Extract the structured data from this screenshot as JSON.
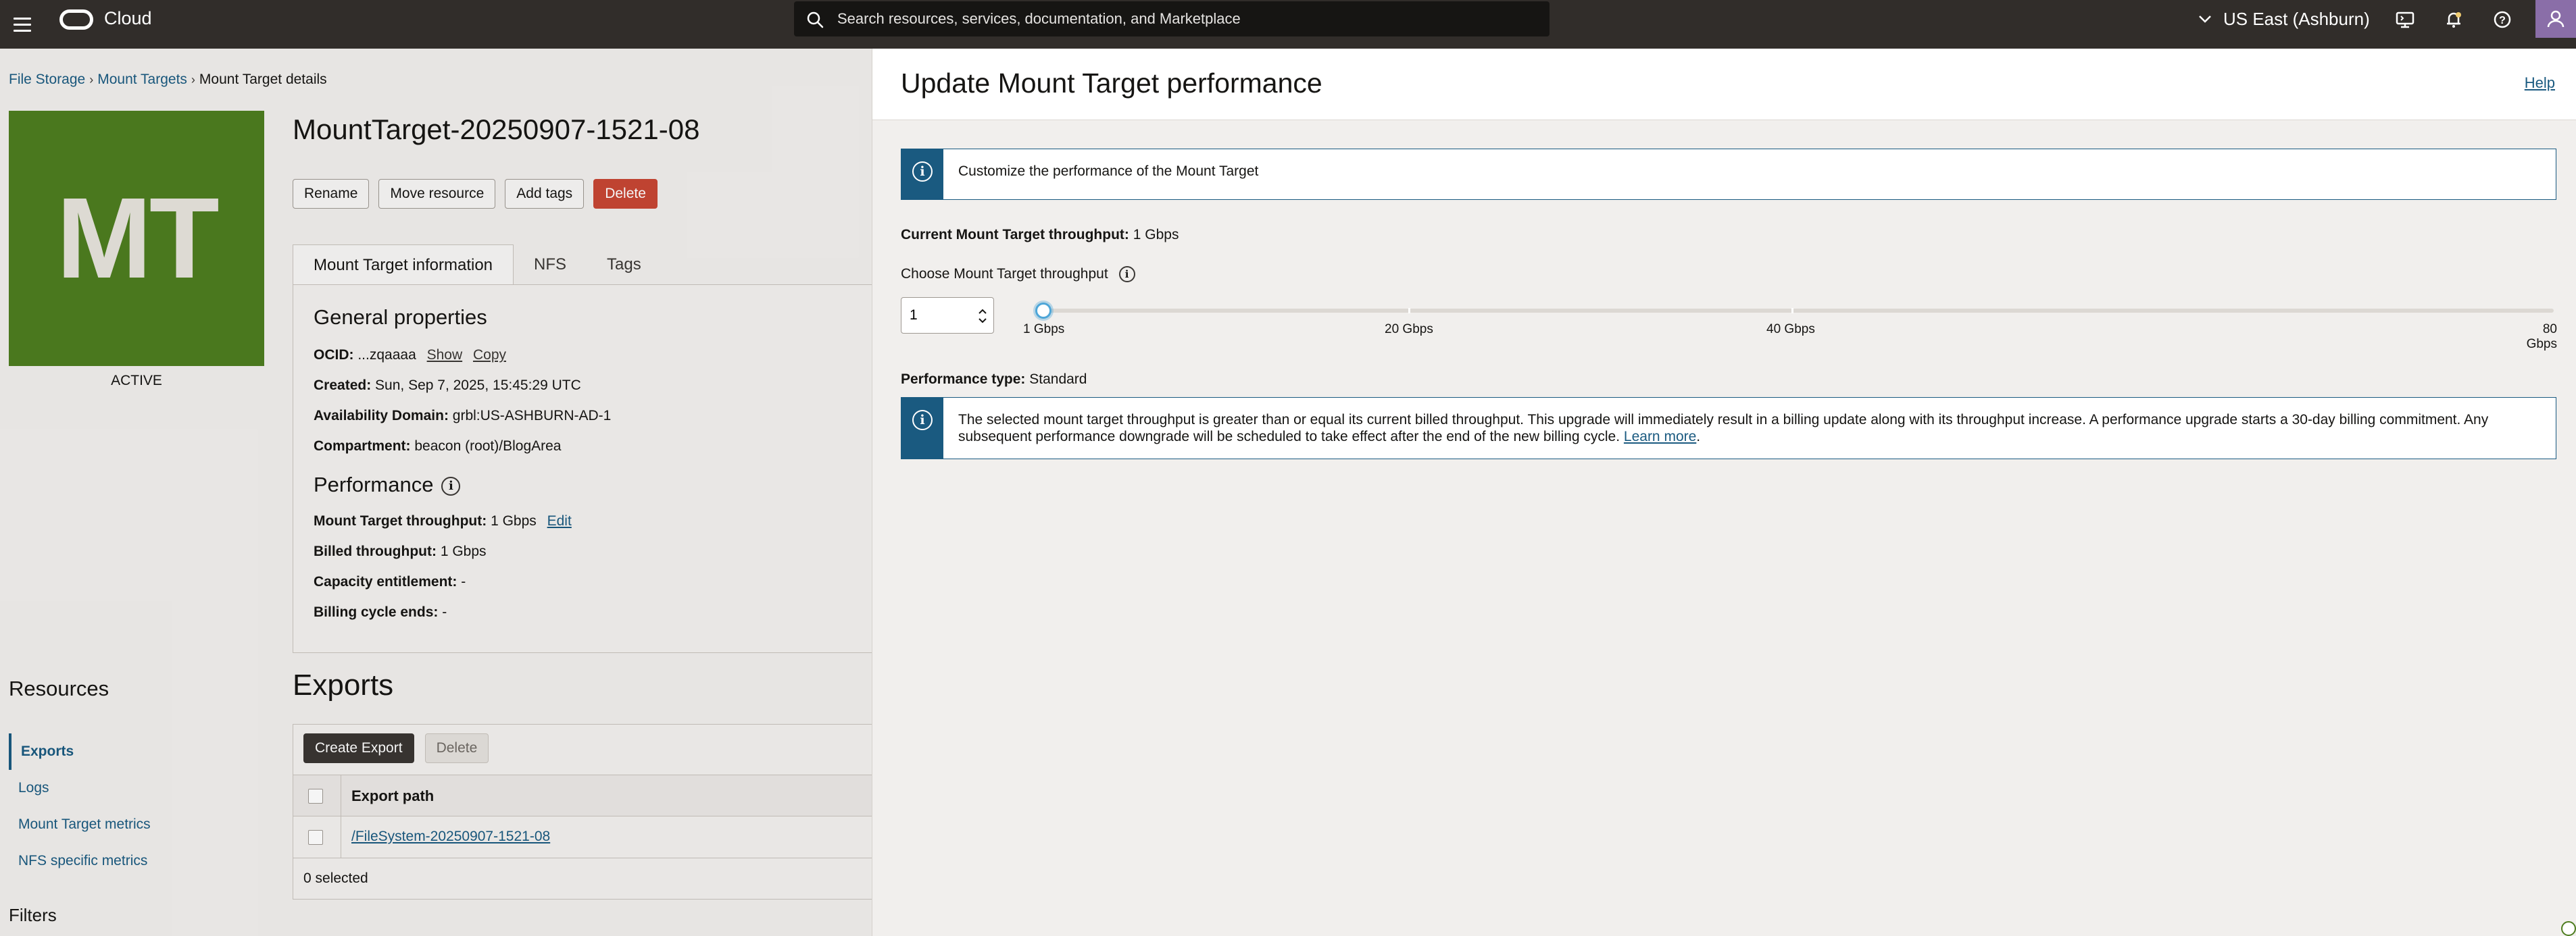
{
  "topbar": {
    "brand": "Cloud",
    "search_placeholder": "Search resources, services, documentation, and Marketplace",
    "region": "US East (Ashburn)"
  },
  "breadcrumb": [
    "File Storage",
    "Mount Targets",
    "Mount Target details"
  ],
  "resource": {
    "logo_text": "MT",
    "status": "ACTIVE",
    "title": "MountTarget-20250907-1521-08",
    "actions": [
      "Rename",
      "Move resource",
      "Add tags",
      "Delete"
    ],
    "tabs": [
      "Mount Target information",
      "NFS",
      "Tags"
    ]
  },
  "general": {
    "heading": "General properties",
    "ocid_label": "OCID:",
    "ocid_value": "...zqaaaa",
    "show": "Show",
    "copy": "Copy",
    "created_label": "Created:",
    "created_value": "Sun, Sep 7, 2025, 15:45:29 UTC",
    "ad_label": "Availability Domain:",
    "ad_value": "grbl:US-ASHBURN-AD-1",
    "compartment_label": "Compartment:",
    "compartment_value": "beacon (root)/BlogArea"
  },
  "performance": {
    "heading": "Performance",
    "throughput_label": "Mount Target throughput:",
    "throughput_value": "1 Gbps",
    "edit": "Edit",
    "billed_label": "Billed throughput:",
    "billed_value": "1 Gbps",
    "capacity_label": "Capacity entitlement:",
    "capacity_value": "-",
    "billing_label": "Billing cycle ends:",
    "billing_value": "-"
  },
  "resources": {
    "title": "Resources",
    "items": [
      "Exports",
      "Logs",
      "Mount Target metrics",
      "NFS specific metrics"
    ],
    "filters": "Filters"
  },
  "exports": {
    "title": "Exports",
    "create": "Create Export",
    "delete": "Delete",
    "column": "Export path",
    "row": "/FileSystem-20250907-1521-08",
    "selected": "0 selected"
  },
  "drawer": {
    "title": "Update Mount Target performance",
    "help": "Help",
    "info": "Customize the performance of the Mount Target",
    "current_label": "Current Mount Target throughput:",
    "current_value": "1 Gbps",
    "choose_label": "Choose Mount Target throughput",
    "stepper_value": "1",
    "slider": {
      "value": 1,
      "min": 1,
      "max": 80,
      "labels": [
        "1 Gbps",
        "20 Gbps",
        "40 Gbps",
        "80 Gbps"
      ]
    },
    "perf_type_label": "Performance type:",
    "perf_type_value": "Standard",
    "warning": "The selected mount target throughput is greater than or equal its current billed throughput. This upgrade will immediately result in a billing update along with its throughput increase. A performance upgrade starts a 30-day billing commitment. Any subsequent performance downgrade will be scheduled to take effect after the end of the new billing cycle.",
    "learn_more": "Learn more"
  },
  "colors": {
    "topbar": "#312d2a",
    "accent": "#1a5a80",
    "danger": "#c74634",
    "logo": "#4e7d20"
  }
}
